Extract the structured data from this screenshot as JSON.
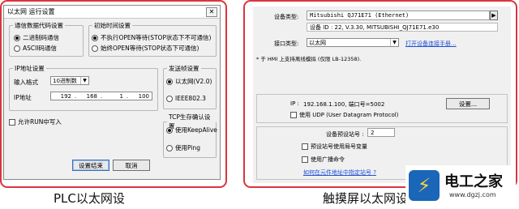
{
  "plc_dialog": {
    "title": "以太网 运行设置",
    "close_glyph": "✕",
    "comm_code": {
      "legend": "通信数据代码设置",
      "options": [
        "二进制码通信",
        "ASCII码通信"
      ],
      "selected": 0
    },
    "init_timing": {
      "legend": "初始时间设置",
      "options": [
        "不执行OPEN等待(STOP状态下不可通信)",
        "始终OPEN等待(STOP状态下可通信)"
      ],
      "selected": 0
    },
    "ip": {
      "legend": "IP地址设置",
      "format_label": "输入格式",
      "format_value": "10进制数",
      "address_label": "IP地址",
      "octets": [
        "192",
        "168",
        "1",
        "100"
      ]
    },
    "send_frame": {
      "legend": "发送帧设置",
      "options": [
        "以太网(V2.0)",
        "IEEE802.3"
      ],
      "selected": 0
    },
    "tcp_keepalive": {
      "legend": "TCP生存确认设置",
      "options": [
        "使用KeepAlive",
        "使用Ping"
      ],
      "selected": 0
    },
    "allow_run_write": {
      "label": "允许RUN中写入",
      "checked": false
    },
    "ok_label": "设置结束",
    "cancel_label": "取消"
  },
  "hmi_panel": {
    "device_type_label": "设备类型:",
    "device_type_value": "Mitsubishi QJ71E71 (Ethernet)",
    "device_info": "设备 ID : 22, V.3.30, MITSUBISHI_QJ71E71.e30",
    "interface_label": "接口类型:",
    "interface_value": "以太网",
    "interface_link": "打开设备连接手册...",
    "note": "* 于 HMI 上支持离线模拟 (仅限 LB-12358).",
    "ip_label": "IP :",
    "ip_value": "192.168.1.100, 端口号=5002",
    "settings_button": "设置...",
    "udp": {
      "label": "使用 UDP (User Datagram Protocol)",
      "checked": false
    },
    "default_station_label": "设备预设站号 :",
    "default_station_value": "2",
    "use_station_var": {
      "label": "预设站号使用局号变量",
      "checked": false
    },
    "use_broadcast": {
      "label": "使用广播命令",
      "checked": false
    },
    "address_station_link": "如何在元件地址中指定站号 ?"
  },
  "captions": {
    "left": "PLC以太网设",
    "right": "触摸屏以太网设"
  },
  "watermark": {
    "badge_glyph": "⚡",
    "title": "电工之家",
    "url": "www.dgzj.com"
  },
  "colors": {
    "frame_red": "#d9363e",
    "link_blue": "#1f4fd6",
    "watermark_blue": "#1a66b8"
  }
}
